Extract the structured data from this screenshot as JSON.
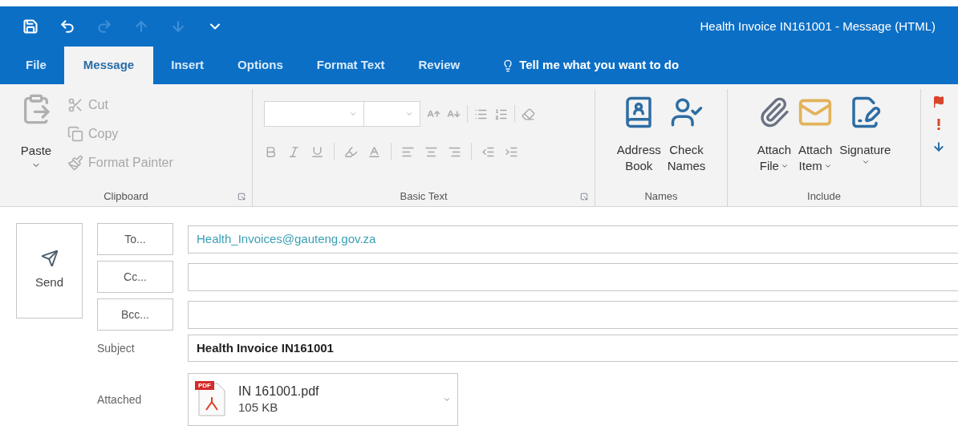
{
  "window": {
    "title": "Health Invoice IN161001  -  Message (HTML)"
  },
  "quick_access": [
    {
      "kind": "save",
      "disabled": false
    },
    {
      "kind": "undo",
      "disabled": false
    },
    {
      "kind": "redo",
      "disabled": true
    },
    {
      "kind": "up",
      "disabled": true
    },
    {
      "kind": "down",
      "disabled": true
    },
    {
      "kind": "customize",
      "disabled": false
    }
  ],
  "tabs": [
    {
      "label": "File",
      "selected": false
    },
    {
      "label": "Message",
      "selected": true
    },
    {
      "label": "Insert",
      "selected": false
    },
    {
      "label": "Options",
      "selected": false
    },
    {
      "label": "Format Text",
      "selected": false
    },
    {
      "label": "Review",
      "selected": false
    }
  ],
  "tell_me": {
    "text": "Tell me what you want to do"
  },
  "ribbon": {
    "clipboard": {
      "label": "Clipboard",
      "paste": {
        "label": "Paste",
        "disabled": false
      },
      "items": [
        {
          "kind": "cut",
          "label": "Cut",
          "disabled": true
        },
        {
          "kind": "copy",
          "label": "Copy",
          "disabled": true
        },
        {
          "kind": "format-painter",
          "label": "Format Painter",
          "disabled": true
        }
      ]
    },
    "basic_text": {
      "label": "Basic Text",
      "disabled": true
    },
    "names": {
      "label": "Names",
      "buttons": [
        {
          "kind": "address-book",
          "lines": [
            "Address",
            "Book"
          ],
          "dropdown": false
        },
        {
          "kind": "check-names",
          "lines": [
            "Check",
            "Names"
          ],
          "dropdown": false
        }
      ]
    },
    "include": {
      "label": "Include",
      "buttons": [
        {
          "kind": "attach-file",
          "lines": [
            "Attach",
            "File"
          ],
          "dropdown": true
        },
        {
          "kind": "attach-item",
          "lines": [
            "Attach",
            "Item"
          ],
          "dropdown": true
        },
        {
          "kind": "signature",
          "lines": [
            "Signature"
          ],
          "dropdown": true
        }
      ]
    },
    "tags": [
      {
        "kind": "flag"
      },
      {
        "kind": "high"
      },
      {
        "kind": "low"
      }
    ]
  },
  "compose": {
    "send": {
      "label": "Send"
    },
    "recipients": [
      {
        "button": "To...",
        "value": "Health_Invoices@gauteng.gov.za"
      },
      {
        "button": "Cc..."
      },
      {
        "button": "Bcc..."
      }
    ],
    "subject": {
      "label": "Subject",
      "value": "Health Invoice IN161001"
    },
    "attached": {
      "label": "Attached",
      "files": [
        {
          "file_type": "PDF",
          "name": "IN 161001.pdf",
          "size": "105 KB"
        }
      ]
    }
  }
}
